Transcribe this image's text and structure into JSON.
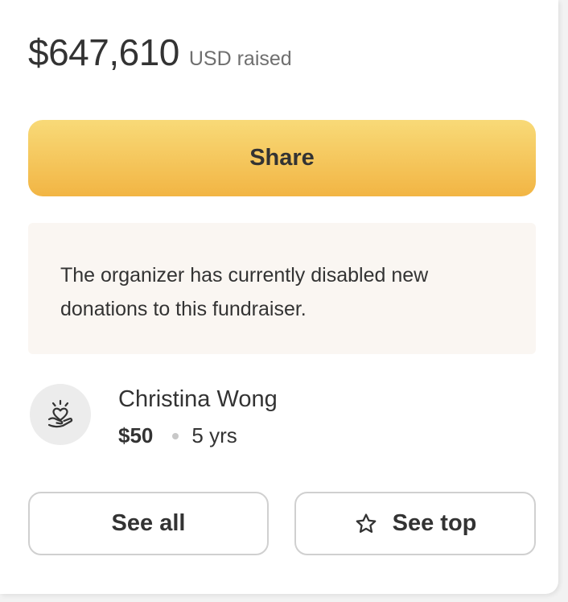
{
  "fundraiser": {
    "amount_raised": "$647,610",
    "currency_label": "USD raised"
  },
  "actions": {
    "share_label": "Share",
    "see_all_label": "See all",
    "see_top_label": "See top"
  },
  "notice": {
    "text": "The organizer has currently disabled new donations to this fundraiser."
  },
  "donation": {
    "donor_name": "Christina Wong",
    "amount": "$50",
    "time_ago": "5 yrs",
    "avatar_icon": "heart-hand-icon"
  },
  "colors": {
    "share_gradient_top": "#f8da78",
    "share_gradient_bottom": "#f2b544",
    "notice_background": "#faf6f2",
    "text": "#333333"
  }
}
